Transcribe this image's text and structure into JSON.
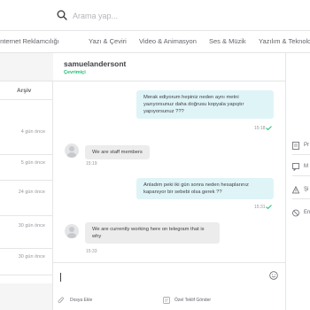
{
  "search": {
    "placeholder": "Arama yap..."
  },
  "categories": [
    "İnternet Reklamcılığı",
    "Yazı & Çeviri",
    "Video & Animasyon",
    "Ses & Müzik",
    "Yazılım & Teknoloji"
  ],
  "sidebar": {
    "archive_label": "Arşiv",
    "times": [
      "4 gün önce",
      "5 gün önce",
      "24 gün önce",
      "30 gün önce",
      "30 gün önce"
    ]
  },
  "chat": {
    "username": "samuelandersont",
    "status": "Çevrimiçi",
    "messages": [
      {
        "direction": "out",
        "text": "Merak ediyorum hepiniz neden aynı metni yazıyorsunuz daha doğrusu kopyala yapıştır yapıyorsunuz ???",
        "time": "15:18"
      },
      {
        "direction": "in",
        "text": "We are staff members",
        "time": "15:19"
      },
      {
        "direction": "out",
        "text": "Anladım peki iki gün sonra neden hesaplarınız kapanıyor bir sebebi olsa gerek ??",
        "time": "15:31"
      },
      {
        "direction": "in",
        "text": "We are currently working here on telegram that is why",
        "time": "15:33"
      }
    ]
  },
  "compose": {
    "attach_label": "Dosya Ekle",
    "offer_label": "Özel Teklif Gönder"
  },
  "side_panel": {
    "items": [
      {
        "icon": "document-icon",
        "label": "Pr"
      },
      {
        "icon": "message-icon",
        "label": "M"
      },
      {
        "icon": "warning-icon",
        "label": "Şi"
      },
      {
        "icon": "block-icon",
        "label": "En"
      }
    ]
  },
  "colors": {
    "accent": "#1dbf73",
    "outgoing_bubble": "#dff4f7",
    "incoming_bubble": "#ececec"
  }
}
